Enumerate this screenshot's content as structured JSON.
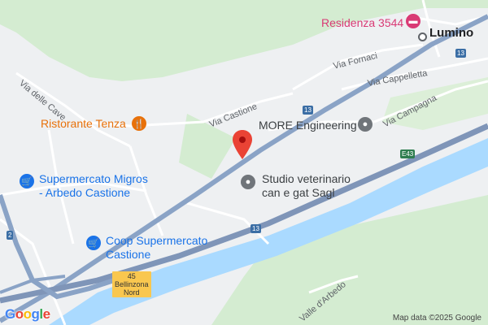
{
  "map": {
    "pins": [
      {
        "name": "Ristorante Tenza",
        "icon": "restaurant-icon",
        "color": "#e8710a"
      },
      {
        "name": "Supermercato Migros\n- Arbedo Castione",
        "icon": "shopping-cart-icon",
        "color": "#1a73e8"
      },
      {
        "name": "Coop Supermercato\nCastione",
        "icon": "shopping-cart-icon",
        "color": "#1a73e8"
      },
      {
        "name": "MORE Engineering",
        "icon": "place-icon",
        "color": "#70757a"
      },
      {
        "name": "Studio veterinario\ncan e gat Sagl",
        "icon": "place-icon",
        "color": "#70757a"
      },
      {
        "name": "Residenza 3544",
        "icon": "hotel-icon",
        "color": "#d93a75"
      }
    ],
    "town": "Lumino",
    "streets": {
      "via_delle_cave": "Via delle Cave",
      "via_castione": "Via Castione",
      "via_fornaci": "Via Fornaci",
      "via_cappelletta": "Via Cappelletta",
      "via_campagna": "Via Campagna",
      "valle_darbedo": "Valle d'Arbedo"
    },
    "route_badges": {
      "r13_a": "13",
      "r13_b": "13",
      "r13_c": "13",
      "e43": "E43",
      "r2": "2"
    },
    "exit_sign": {
      "number": "45",
      "name": "Bellinzona\nNord"
    },
    "attribution": "Map data ©2025 Google",
    "logo": [
      "G",
      "o",
      "o",
      "g",
      "l",
      "e"
    ],
    "logo_colors": [
      "#4285f4",
      "#ea4335",
      "#fbbc05",
      "#4285f4",
      "#34a853",
      "#ea4335"
    ],
    "colors": {
      "water": "#aadaff",
      "green": "#d4ecd1",
      "highway": "#8aa3c6",
      "road": "#ffffff",
      "pin": "#ea4335"
    }
  }
}
